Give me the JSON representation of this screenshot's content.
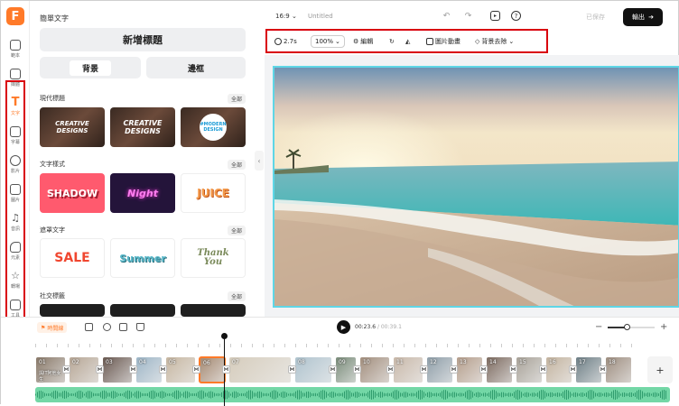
{
  "app": {
    "logo_letter": "F",
    "accent": "#ff7a29"
  },
  "rail": [
    {
      "label": "範本",
      "icon": "template-icon"
    },
    {
      "label": "媒體",
      "icon": "media-icon"
    },
    {
      "label": "文字",
      "icon": "text-icon",
      "active": true
    },
    {
      "label": "字幕",
      "icon": "subtitle-icon"
    },
    {
      "label": "影片",
      "icon": "video-icon"
    },
    {
      "label": "圖片",
      "icon": "image-icon"
    },
    {
      "label": "音訊",
      "icon": "music-icon"
    },
    {
      "label": "元素",
      "icon": "elements-icon"
    },
    {
      "label": "轉場",
      "icon": "transition-icon"
    },
    {
      "label": "工具",
      "icon": "tools-icon"
    }
  ],
  "panel": {
    "title": "簡單文字",
    "add_title": "新增標題",
    "bg_label": "背景",
    "frame_label": "邊框",
    "all_label": "全部",
    "sections": [
      {
        "title": "現代標題",
        "items": [
          "CREATIVE DESIGNS",
          "CREATIVE DESIGNS",
          "#MODERN DESIGN"
        ]
      },
      {
        "title": "文字樣式",
        "items": [
          "SHADOW",
          "Night",
          "JUICE"
        ]
      },
      {
        "title": "遮罩文字",
        "items": [
          "SALE",
          "Summer",
          "Thank You"
        ]
      },
      {
        "title": "社交標籤",
        "items": []
      }
    ]
  },
  "topbar": {
    "ratio": "16:9",
    "project_title": "Untitled",
    "saved": "已保存",
    "export_label": "輸出"
  },
  "toolbar": {
    "duration": "2.7s",
    "zoom": "100%",
    "edit": "編輯",
    "animation": "圖片動畫",
    "bg_remove": "背景去除"
  },
  "timeline": {
    "button_label": "時間線",
    "current_time": "00:23.6",
    "total_time": "/ 00:39.1",
    "zoom_level": 0.35,
    "clips": [
      "01",
      "02",
      "03",
      "04",
      "05",
      "06",
      "07",
      "08",
      "09",
      "10",
      "11",
      "12",
      "13",
      "14",
      "15",
      "16",
      "17",
      "18"
    ],
    "clip_caption": "與IT阿他女生",
    "add_label": "+"
  }
}
